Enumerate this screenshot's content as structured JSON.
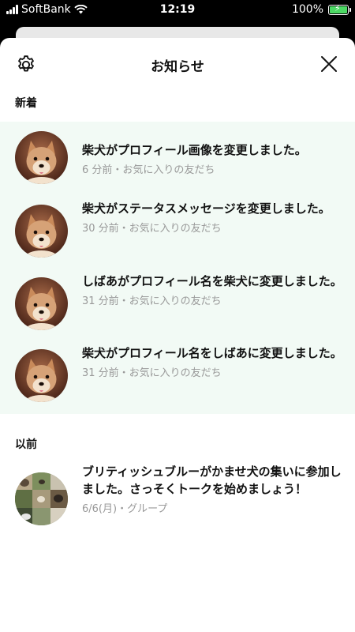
{
  "status_bar": {
    "carrier": "SoftBank",
    "time": "12:19",
    "battery": "100%"
  },
  "header": {
    "title": "お知らせ",
    "settings_icon": "gear-icon",
    "close_icon": "close-icon"
  },
  "sections": {
    "new_label": "新着",
    "old_label": "以前"
  },
  "new_items": [
    {
      "message": "柴犬がプロフィール画像を変更しました。",
      "meta": "6 分前・お気に入りの友だち"
    },
    {
      "message": "柴犬がステータスメッセージを変更しました。",
      "meta": "30 分前・お気に入りの友だち"
    },
    {
      "message": "しばあがプロフィール名を柴犬に変更しました。",
      "meta": "31 分前・お気に入りの友だち"
    },
    {
      "message": "柴犬がプロフィール名をしばあに変更しました。",
      "meta": "31 分前・お気に入りの友だち"
    }
  ],
  "old_items": [
    {
      "message": "ブリティッシュブルーがかませ犬の集いに参加しました。さっそくトークを始めましょう！",
      "meta": "6/6(月)・グループ"
    }
  ],
  "colors": {
    "new_background": "#f2faf5",
    "meta_text": "#999999",
    "battery_fill": "#4cd964"
  }
}
